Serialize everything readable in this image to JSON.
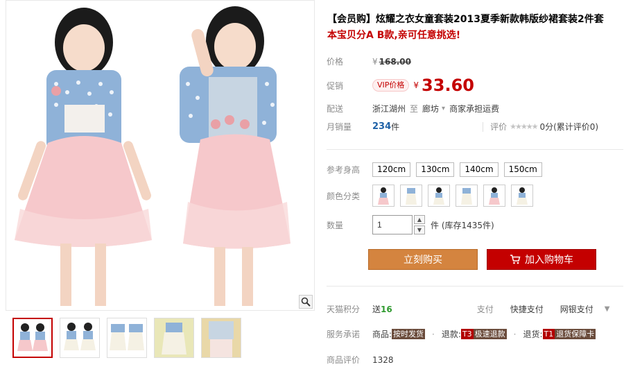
{
  "product": {
    "title": "【会员购】炫耀之衣女童套装2013夏季新款韩版纱裙套装2件套",
    "subtitle": "本宝贝分A B款,亲可任意挑选!"
  },
  "price": {
    "label": "价格",
    "currency": "¥",
    "original": "168.00"
  },
  "promo": {
    "label": "促销",
    "tag": "VIP价格",
    "currency": "¥",
    "price": "33.60"
  },
  "shipping": {
    "label": "配送",
    "from": "浙江湖州",
    "to_word": "至",
    "dest": "廊坊",
    "note": "商家承担运费"
  },
  "sales": {
    "label": "月销量",
    "count": "234",
    "unit": "件",
    "rating_label": "评价",
    "stars": "★★★★★",
    "rating_text": "0分(累计评价0)"
  },
  "options": {
    "size_label": "参考身高",
    "sizes": [
      "120cm",
      "130cm",
      "140cm",
      "150cm"
    ],
    "color_label": "颜色分类"
  },
  "quantity": {
    "label": "数量",
    "value": "1",
    "unit_stock": "件 (库存1435件)"
  },
  "actions": {
    "buy_now": "立刻购买",
    "add_cart": "加入购物车"
  },
  "points": {
    "label": "天猫积分",
    "prefix": "送",
    "value": "16",
    "pay1": "支付",
    "pay2": "快捷支付",
    "pay3": "网银支付"
  },
  "service": {
    "label": "服务承诺",
    "item1_prefix": "商品:",
    "item1_badge": "按时发货",
    "item2_prefix": "退款:",
    "item2_badge_a": "T3",
    "item2_badge_b": "极速退款",
    "item3_prefix": "退货:",
    "item3_badge_a": "T1",
    "item3_badge_b": "退货保障卡"
  },
  "reviews": {
    "label": "商品评价",
    "value": "1328"
  },
  "colors": {
    "brand_red": "#c40000",
    "buy_orange": "#d4843f",
    "points_green": "#2f9a2f",
    "sales_blue": "#2062a7"
  },
  "icons": [
    "zoom-icon",
    "cart-icon",
    "stepper-up-icon",
    "stepper-down-icon",
    "dropdown-arrow-icon"
  ]
}
